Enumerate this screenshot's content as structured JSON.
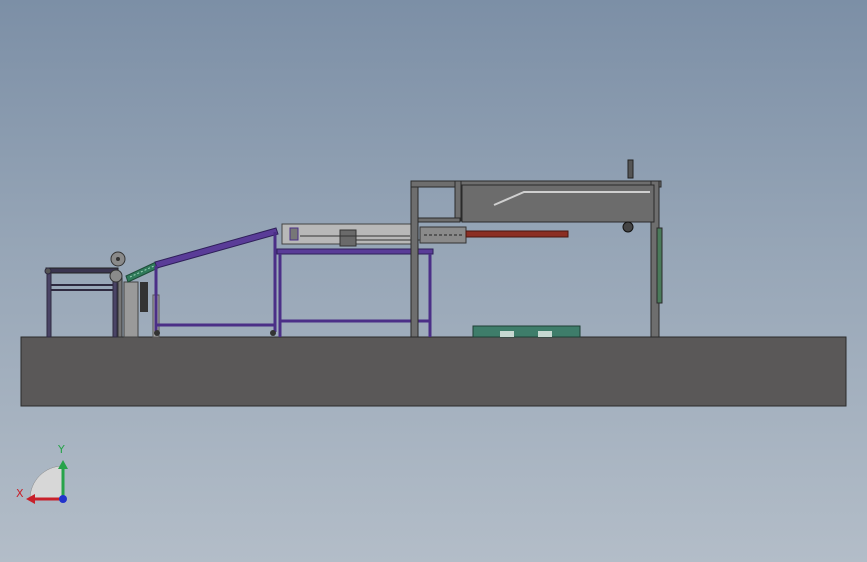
{
  "window": {
    "title": ""
  },
  "viewport": {
    "background": "#97a6b7",
    "view": "front-orthographic"
  },
  "model": {
    "name": "",
    "parts": [
      {
        "id": "base-plate",
        "color": "#5a5858"
      },
      {
        "id": "infeed-conveyor",
        "color": "#3a3550"
      },
      {
        "id": "incline-conveyor",
        "color": "#4b2f87"
      },
      {
        "id": "main-table",
        "color": "#4b2f87"
      },
      {
        "id": "roller-assembly",
        "color": "#707070"
      },
      {
        "id": "chain-guide",
        "color": "#2f7a5a"
      },
      {
        "id": "overhead-frame",
        "color": "#6e6e6e"
      },
      {
        "id": "gantry-box",
        "color": "#6c6c6c"
      },
      {
        "id": "red-rail",
        "color": "#8b2e23"
      },
      {
        "id": "circuit-board",
        "color": "#3e7d6a"
      }
    ]
  },
  "triad": {
    "x_label": "X",
    "y_label": "Y",
    "x_color": "#c8202a",
    "y_color": "#27a34a",
    "z_color": "#2233cc"
  }
}
